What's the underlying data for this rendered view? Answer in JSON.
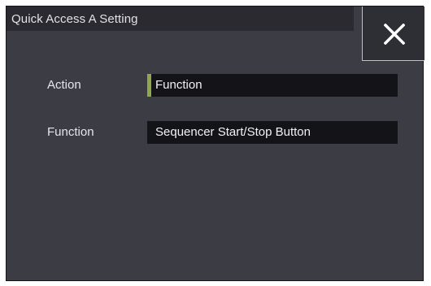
{
  "dialog": {
    "title": "Quick Access A Setting",
    "close_icon": "close-icon"
  },
  "fields": {
    "action": {
      "label": "Action",
      "value": "Function"
    },
    "function": {
      "label": "Function",
      "value": "Sequencer Start/Stop Button"
    }
  },
  "colors": {
    "accent": "#8fa84e",
    "background": "#3c3c44",
    "field_background": "#141418"
  }
}
